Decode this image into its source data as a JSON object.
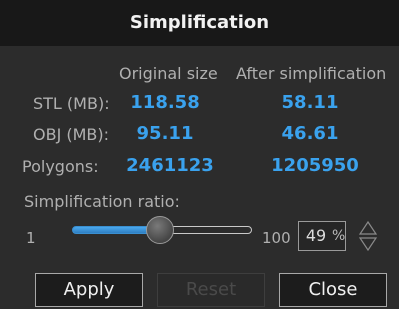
{
  "dialog": {
    "title": "Simplification"
  },
  "table": {
    "col_original": "Original size",
    "col_after": "After simplification",
    "rows": [
      {
        "label": "STL (MB):",
        "original": "118.58",
        "after": "58.11"
      },
      {
        "label": "OBJ (MB):",
        "original": "95.11",
        "after": "46.61"
      },
      {
        "label": "Polygons:",
        "original": "2461123",
        "after": "1205950"
      }
    ]
  },
  "ratio": {
    "label": "Simplification ratio:",
    "min_label": "1",
    "max_label": "100",
    "value": "49",
    "unit": "%",
    "slider_fraction": 0.49
  },
  "buttons": {
    "apply": "Apply",
    "reset": "Reset",
    "close": "Close"
  },
  "colors": {
    "accent": "#3aa2ee",
    "title_bg": "#181818",
    "body_bg": "#2c2c2c",
    "label": "#b0b0b0"
  },
  "icons": {
    "spin": "up-down-arrows-icon"
  }
}
